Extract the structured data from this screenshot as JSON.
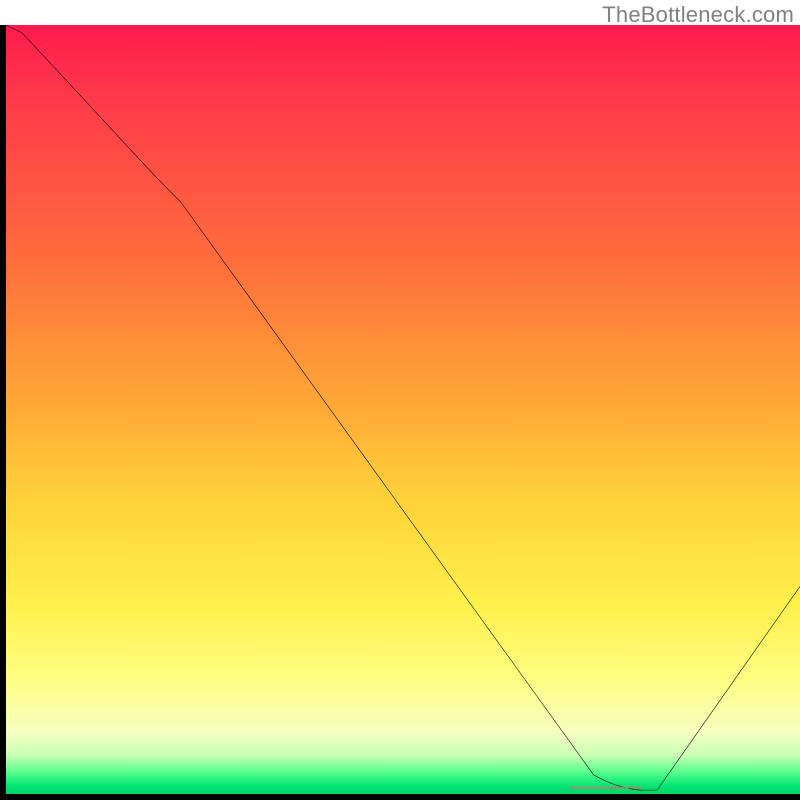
{
  "watermark": "TheBottleneck.com",
  "colors": {
    "axis": "#000000",
    "curve": "#000000",
    "marker": "#e26a6a",
    "gradient_top": "#ff1a4d",
    "gradient_bottom": "#00d268"
  },
  "chart_data": {
    "type": "line",
    "title": "",
    "xlabel": "",
    "ylabel": "",
    "xlim": [
      0,
      100
    ],
    "ylim": [
      0,
      100
    ],
    "grid": false,
    "legend": false,
    "x": [
      0,
      2,
      22,
      74,
      80,
      82,
      100
    ],
    "values": [
      100,
      99,
      77,
      2.5,
      0.5,
      0.5,
      27
    ],
    "marker_segment": {
      "x_start": 71,
      "x_end": 80,
      "y": 0.8
    },
    "notes": "Values are percentage-of-height estimates read from the axis-free gradient plot. 100 = top of plot, 0 = bottom. Curve starts upper-left, has a slight convex knee near x≈22, drops nearly linearly to a flat bottom around x≈74–82, then rises back up toward the right edge reaching roughly 27% height."
  }
}
